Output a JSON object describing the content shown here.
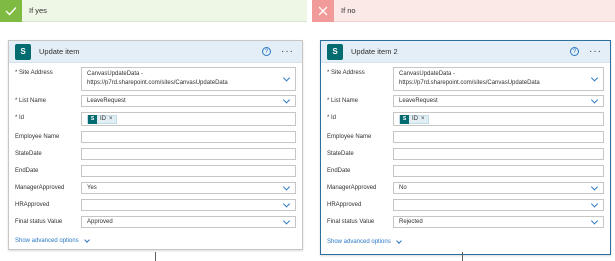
{
  "yes": {
    "branch_label": "If yes",
    "card_title": "Update item",
    "site_label": "* Site Address",
    "site_line1": "CanvasUpdateData -",
    "site_line2": "https://p7rd.sharepoint.com/sites/CanvasUpdateData",
    "list_label": "* List Name",
    "list_value": "LeaveRequest",
    "id_label": "* Id",
    "id_token": "ID",
    "employee_label": "Employee Name",
    "employee_value": "",
    "statedate_label": "StateDate",
    "statedate_value": "",
    "enddate_label": "EndDate",
    "enddate_value": "",
    "manager_label": "ManagerApproved",
    "manager_value": "Yes",
    "hr_label": "HRApproved",
    "hr_value": "",
    "final_label": "Final status Value",
    "final_value": "Approved",
    "advanced": "Show advanced options"
  },
  "no": {
    "branch_label": "If no",
    "card_title": "Update item 2",
    "site_label": "* Site Address",
    "site_line1": "CanvasUpdateData -",
    "site_line2": "https://p7rd.sharepoint.com/sites/CanvasUpdateData",
    "list_label": "* List Name",
    "list_value": "LeaveRequest",
    "id_label": "* Id",
    "id_token": "ID",
    "employee_label": "Employee Name",
    "employee_value": "",
    "statedate_label": "StateDate",
    "statedate_value": "",
    "enddate_label": "EndDate",
    "enddate_value": "",
    "manager_label": "ManagerApproved",
    "manager_value": "No",
    "hr_label": "HRApproved",
    "hr_value": "",
    "final_label": "Final status Value",
    "final_value": "Rejected",
    "advanced": "Show advanced options"
  },
  "icons": {
    "sharepoint_letter": "S",
    "help_glyph": "?",
    "more_glyph": "···",
    "remove_glyph": "×",
    "check_glyph": "✓",
    "close_glyph": "✕"
  },
  "colors": {
    "yes_accent": "#7fba43",
    "no_accent": "#f09a9a",
    "sharepoint": "#036c70",
    "link": "#2b78c5",
    "selected_border": "#2b6f9e"
  }
}
